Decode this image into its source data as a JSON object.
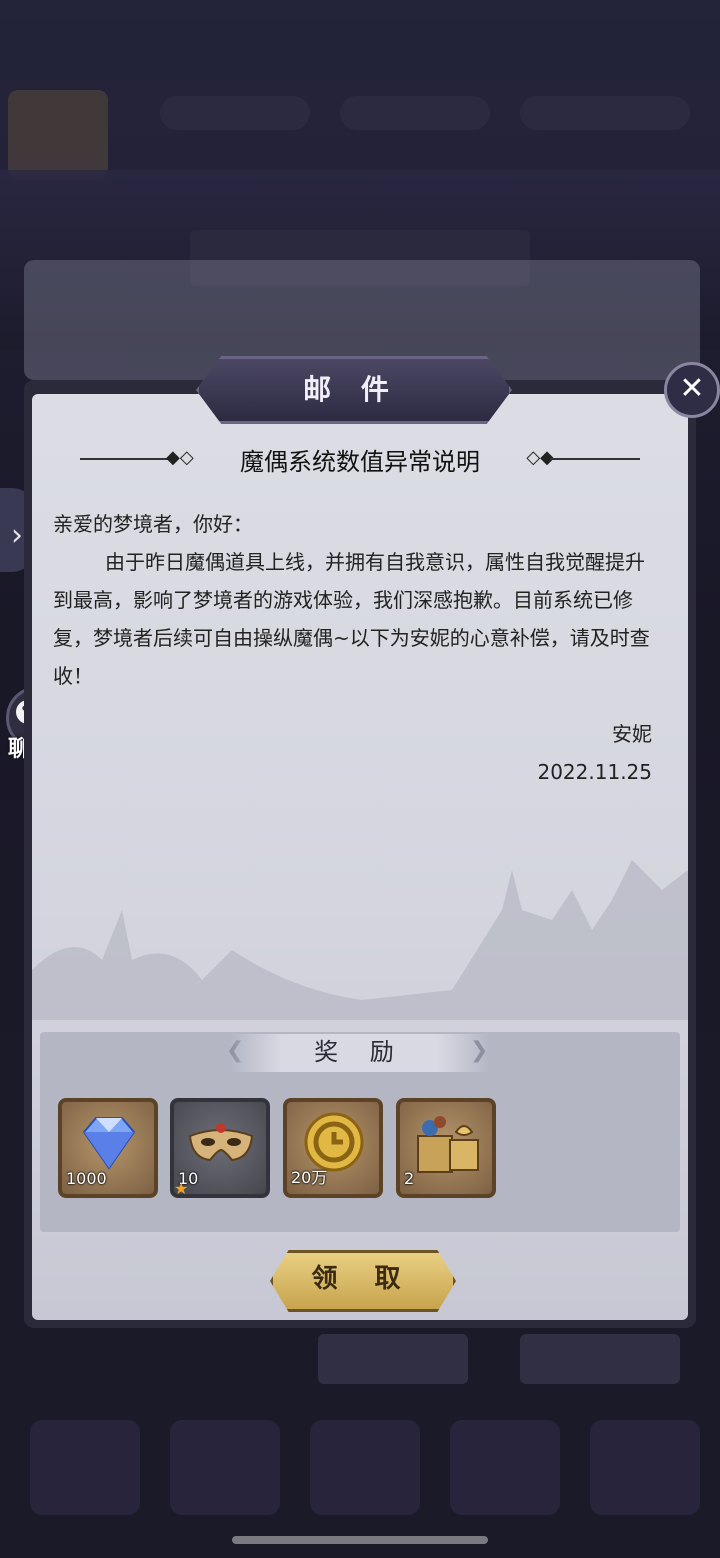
{
  "modal": {
    "title": "邮 件",
    "close_icon": "close-icon",
    "heading": "魔偶系统数值异常说明",
    "greeting": "亲爱的梦境者，你好：",
    "paragraph": "由于昨日魔偶道具上线，并拥有自我意识，属性自我觉醒提升到最高，影响了梦境者的游戏体验，我们深感抱歉。目前系统已修复，梦境者后续可自由操纵魔偶~以下为安妮的心意补偿，请及时查收！",
    "signature": "安妮",
    "date": "2022.11.25"
  },
  "rewards": {
    "title": "奖 励",
    "items": [
      {
        "icon": "diamond-icon",
        "count": "1000"
      },
      {
        "icon": "mask-icon",
        "count": "10"
      },
      {
        "icon": "gold-coin-icon",
        "count": "20万"
      },
      {
        "icon": "gift-box-icon",
        "count": "2"
      }
    ],
    "claim_label": "领 取"
  },
  "side": {
    "chat_label": "聊 天",
    "chat_icon": "chat-bubble-icon",
    "expand_icon": "chevron-right-icon"
  }
}
